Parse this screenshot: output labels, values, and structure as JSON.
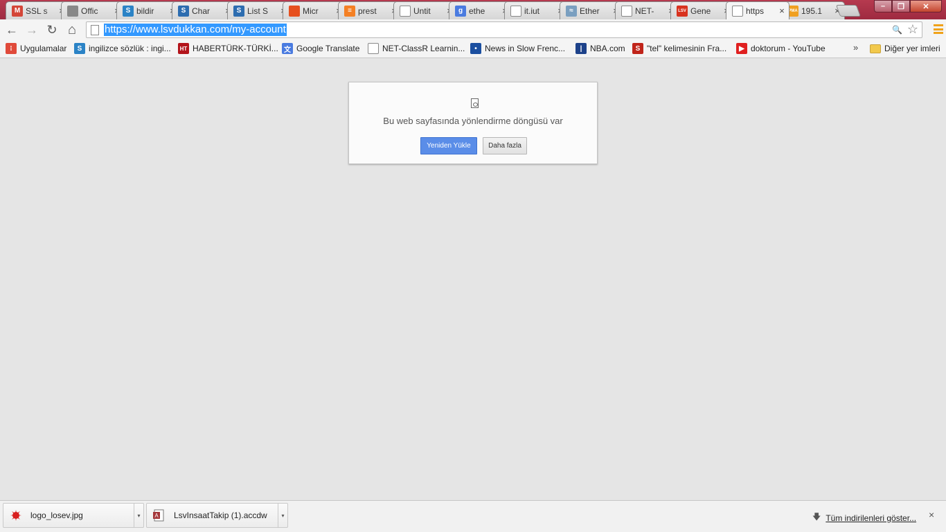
{
  "tabs": [
    {
      "title": "SSL s",
      "icon": "gmail-icon",
      "color": "#d44638",
      "glyph": "M"
    },
    {
      "title": "Offic",
      "icon": "office-icon",
      "color": "#888888",
      "glyph": ""
    },
    {
      "title": "bildir",
      "icon": "s-icon",
      "color": "#2b83c6",
      "glyph": "S"
    },
    {
      "title": "Char",
      "icon": "sharepoint-icon",
      "color": "#2d6db0",
      "glyph": "S"
    },
    {
      "title": "List S",
      "icon": "sharepoint-icon",
      "color": "#2d6db0",
      "glyph": "S"
    },
    {
      "title": "Micr",
      "icon": "office-icon",
      "color": "#e6501f",
      "glyph": ""
    },
    {
      "title": "prest",
      "icon": "stackoverflow-icon",
      "color": "#f48024",
      "glyph": "≡"
    },
    {
      "title": "Untit",
      "icon": "page-icon",
      "color": "#ffffff",
      "glyph": ""
    },
    {
      "title": "ethe",
      "icon": "google-icon",
      "color": "#4a7be0",
      "glyph": "g"
    },
    {
      "title": "it.iut",
      "icon": "page-icon",
      "color": "#ffffff",
      "glyph": ""
    },
    {
      "title": "Ether",
      "icon": "ethernet-icon",
      "color": "#7a9fc0",
      "glyph": "≈"
    },
    {
      "title": "NET-",
      "icon": "page-icon",
      "color": "#ffffff",
      "glyph": ""
    },
    {
      "title": "Gene",
      "icon": "lsv-icon",
      "color": "#d8321e",
      "glyph": "LSV"
    },
    {
      "title": "https",
      "icon": "page-icon",
      "color": "#ffffff",
      "glyph": "",
      "active": true
    },
    {
      "title": "195.1",
      "icon": "pma-icon",
      "color": "#f0a020",
      "glyph": "PMA"
    }
  ],
  "toolbar": {
    "url": "https://www.lsvdukkan.com/my-account",
    "back_glyph": "←",
    "forward_glyph": "→",
    "reload_glyph": "↻",
    "home_glyph": "⌂",
    "star_glyph": "☆",
    "zoom_glyph": "🔍"
  },
  "bookmarks": [
    {
      "label": "Uygulamalar",
      "icon": "apps-grid-icon",
      "color": "#e04a3a",
      "glyph": "⁝"
    },
    {
      "label": "ingilizce sözlük : ingi...",
      "icon": "s-icon",
      "color": "#2b83c6",
      "glyph": "S"
    },
    {
      "label": "HABERTÜRK-TÜRKİ...",
      "icon": "haberturk-icon",
      "color": "#b3141b",
      "glyph": "HT"
    },
    {
      "label": "Google Translate",
      "icon": "translate-icon",
      "color": "#4a7be0",
      "glyph": "文"
    },
    {
      "label": "NET-ClassR Learnin...",
      "icon": "page-icon",
      "color": "#ffffff",
      "glyph": ""
    },
    {
      "label": "News in Slow Frenc...",
      "icon": "news-icon",
      "color": "#1b4fa0",
      "glyph": "•"
    },
    {
      "label": "NBA.com",
      "icon": "nba-icon",
      "color": "#1d428a",
      "glyph": "|"
    },
    {
      "label": "\"tel\" kelimesinin Fra...",
      "icon": "reverso-icon",
      "color": "#c0241a",
      "glyph": "S"
    },
    {
      "label": "doktorum - YouTube",
      "icon": "youtube-icon",
      "color": "#e02020",
      "glyph": "▶"
    }
  ],
  "bookmarks_overflow": "»",
  "bookmarks_other": "Diğer yer imleri",
  "error": {
    "message": "Bu web sayfasında yönlendirme döngüsü var",
    "reload_label": "Yeniden Yükle",
    "more_label": "Daha fazla"
  },
  "downloads": {
    "items": [
      {
        "name": "logo_losev.jpg",
        "icon": "image-file-icon"
      },
      {
        "name": "LsvInsaatTakip (1).accdw",
        "icon": "access-file-icon"
      }
    ],
    "show_all": "Tüm indirilenleri göster...",
    "close_glyph": "×"
  }
}
